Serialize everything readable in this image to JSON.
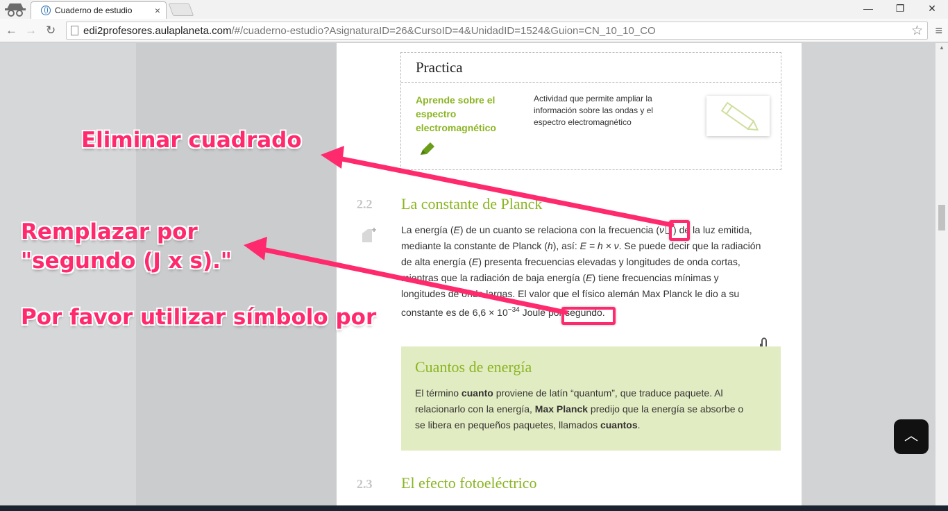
{
  "browser": {
    "tab_title": "Cuaderno de estudio",
    "tab_close": "×",
    "url_host": "edi2profesores.aulaplaneta.com",
    "url_rest": "/#/cuaderno-estudio?AsignaturaID=26&CursoID=4&UnidadID=1524&Guion=CN_10_10_CO",
    "win_minimize": "—",
    "win_restore": "❐",
    "win_close": "✕",
    "back": "←",
    "forward": "→",
    "reload": "↻",
    "star": "☆",
    "menu": "≡"
  },
  "practica": {
    "heading": "Practica",
    "activity_title": "Aprende sobre el espectro electromagnético",
    "activity_desc": "Actividad que permite ampliar la información sobre las ondas y el espectro electromagnético"
  },
  "section_22": {
    "number": "2.2",
    "title": "La constante de Planck",
    "p_a": "La energía (",
    "p_E": "E",
    "p_b": ") de un cuanto se relaciona con la frecuencia (",
    "p_v": "ν",
    "p_c": ") de la luz emitida, mediante la constante de Planck (",
    "p_h": "h",
    "p_d": "), así: ",
    "p_formula": "E = h × ν",
    "p_e": ". Se puede decir que la radiación de alta energía (",
    "p_E2": "E",
    "p_f": ") presenta frecuencias elevadas y longitudes de onda cortas, mientras que la radiación de baja energía (",
    "p_E3": "E",
    "p_g": ") tiene frecuencias mínimas y longitudes de onda largas. El valor que el físico alemán Max Planck le dio a su constante es de 6,6 × 10",
    "p_exp": "−34",
    "p_h2": " Joule por segundo."
  },
  "callout": {
    "title": "Cuantos de energía",
    "t1": "El término ",
    "b1": "cuanto",
    "t2": " proviene de latín “quantum”, que traduce paquete. Al relacionarlo con la energía, ",
    "b2": "Max Planck",
    "t3": " predijo que la energía se absorbe o se libera en pequeños paquetes, llamados ",
    "b3": "cuantos",
    "t4": "."
  },
  "section_23": {
    "number": "2.3",
    "title": "El efecto fotoeléctrico"
  },
  "annotations": {
    "a1": "Eliminar cuadrado",
    "a2_line1": "Remplazar por",
    "a2_line2": "\"segundo (J x s).\"",
    "a3": "Por favor utilizar símbolo por",
    "color": "#ff2a6e"
  },
  "scroll_top_label": "︿"
}
